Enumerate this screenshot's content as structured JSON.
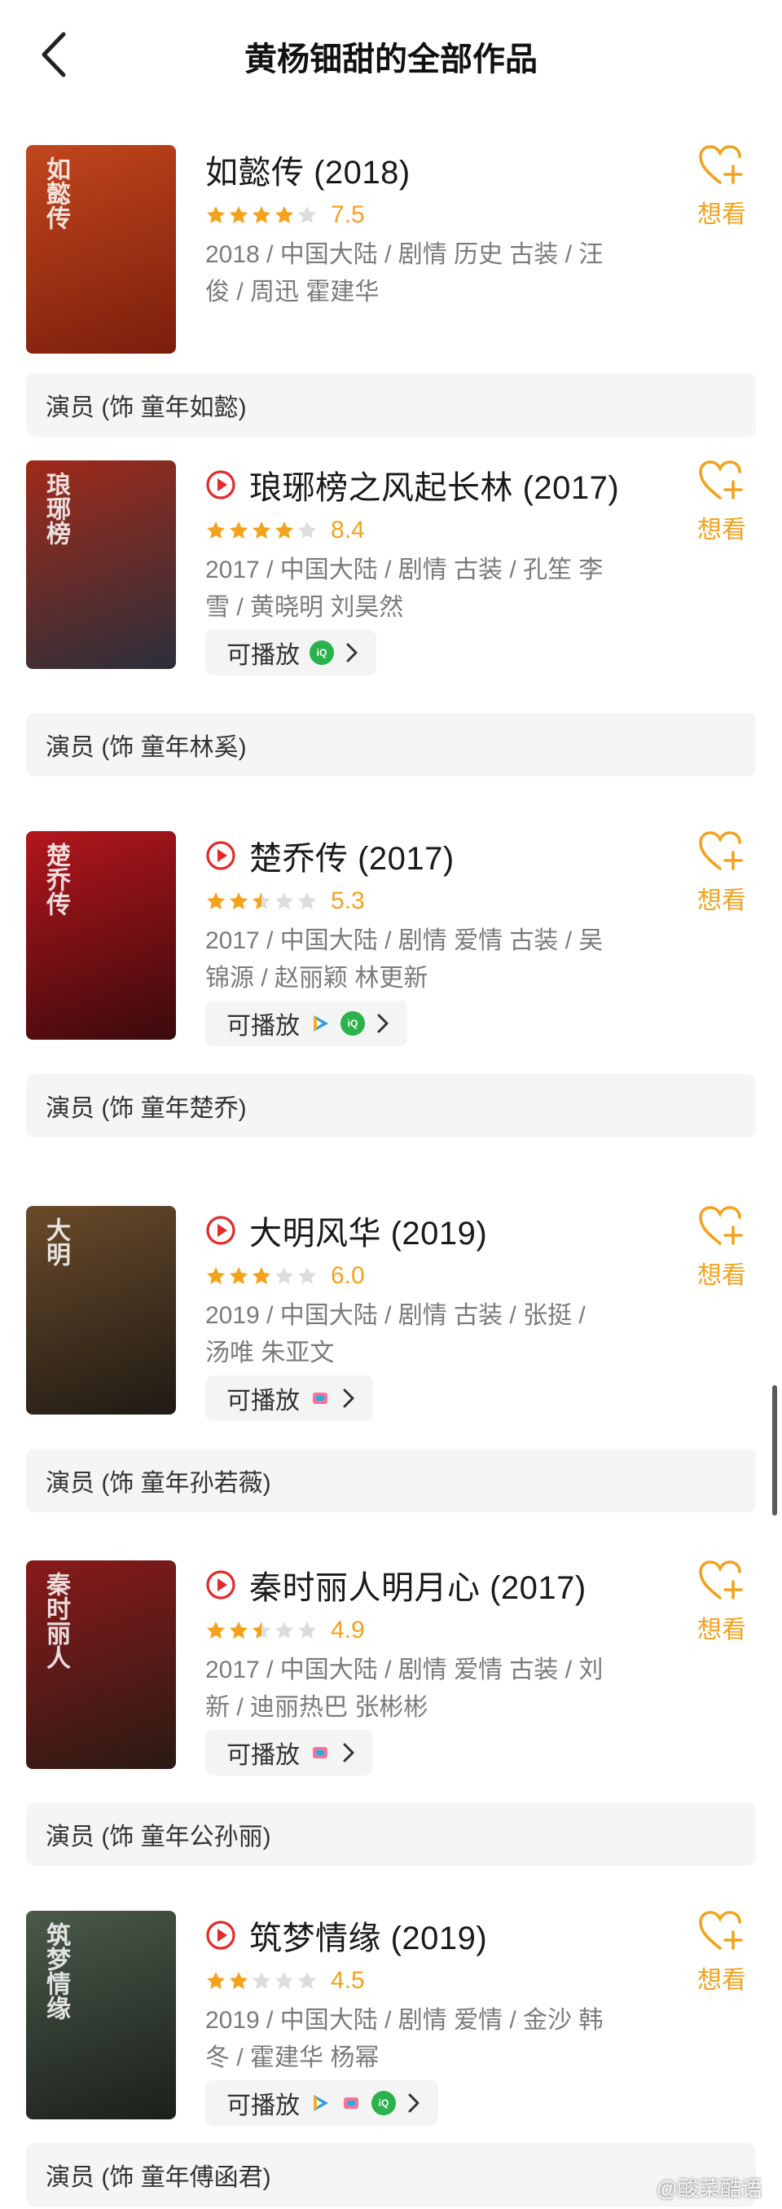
{
  "header": {
    "title": "黄杨钿甜的全部作品"
  },
  "common": {
    "want_label": "想看",
    "playable_label": "可播放"
  },
  "colors": {
    "accent": "#f3a21c",
    "play_red": "#e22b2b",
    "star_on": "#f3a21c",
    "star_off": "#dddddd"
  },
  "works": [
    {
      "title": "如懿传 (2018)",
      "score": "7.5",
      "stars": 4,
      "info": "2018 / 中国大陆 / 剧情 历史 古装 / 汪俊 / 周迅 霍建华",
      "role": "演员 (饰 童年如懿)",
      "poster_text": "如懿传",
      "poster_colors": [
        "#c2461c",
        "#7a1e0c"
      ],
      "platforms": []
    },
    {
      "title": "琅琊榜之风起长林 (2017)",
      "score": "8.4",
      "stars": 4,
      "info": "2017 / 中国大陆 / 剧情 古装 / 孔笙 李雪 / 黄晓明 刘昊然",
      "role": "演员 (饰 童年林奚)",
      "poster_text": "琅琊榜",
      "poster_colors": [
        "#a12a1a",
        "#2a2f3a"
      ],
      "platforms": [
        "iqiyi"
      ]
    },
    {
      "title": "楚乔传 (2017)",
      "score": "5.3",
      "stars": 2.5,
      "info": "2017 / 中国大陆 / 剧情 爱情 古装 / 吴锦源 / 赵丽颖 林更新",
      "role": "演员 (饰 童年楚乔)",
      "poster_text": "楚乔传",
      "poster_colors": [
        "#b3161c",
        "#3a0a0c"
      ],
      "platforms": [
        "tencent",
        "iqiyi"
      ]
    },
    {
      "title": "大明风华 (2019)",
      "score": "6.0",
      "stars": 3,
      "info": "2019 / 中国大陆 / 剧情 古装 / 张挺 / 汤唯 朱亚文",
      "role": "演员 (饰 童年孙若薇)",
      "poster_text": "大明",
      "poster_colors": [
        "#6a4a2a",
        "#1f1a14"
      ],
      "platforms": [
        "bilibili"
      ]
    },
    {
      "title": "秦时丽人明月心 (2017)",
      "score": "4.9",
      "stars": 2.5,
      "info": "2017 / 中国大陆 / 剧情 爱情 古装 / 刘新 / 迪丽热巴 张彬彬",
      "role": "演员 (饰 童年公孙丽)",
      "poster_text": "秦时丽人",
      "poster_colors": [
        "#8a1a1a",
        "#2a1a14"
      ],
      "platforms": [
        "bilibili"
      ]
    },
    {
      "title": "筑梦情缘 (2019)",
      "score": "4.5",
      "stars": 2,
      "info": "2019 / 中国大陆 / 剧情 爱情 / 金沙 韩冬 / 霍建华 杨幂",
      "role": "演员 (饰 童年傅函君)",
      "poster_text": "筑梦情缘",
      "poster_colors": [
        "#4a5a4a",
        "#1a1f1a"
      ],
      "platforms": [
        "tencent",
        "bilibili",
        "iqiyi"
      ]
    }
  ],
  "watermark": "@酸菜酷语"
}
